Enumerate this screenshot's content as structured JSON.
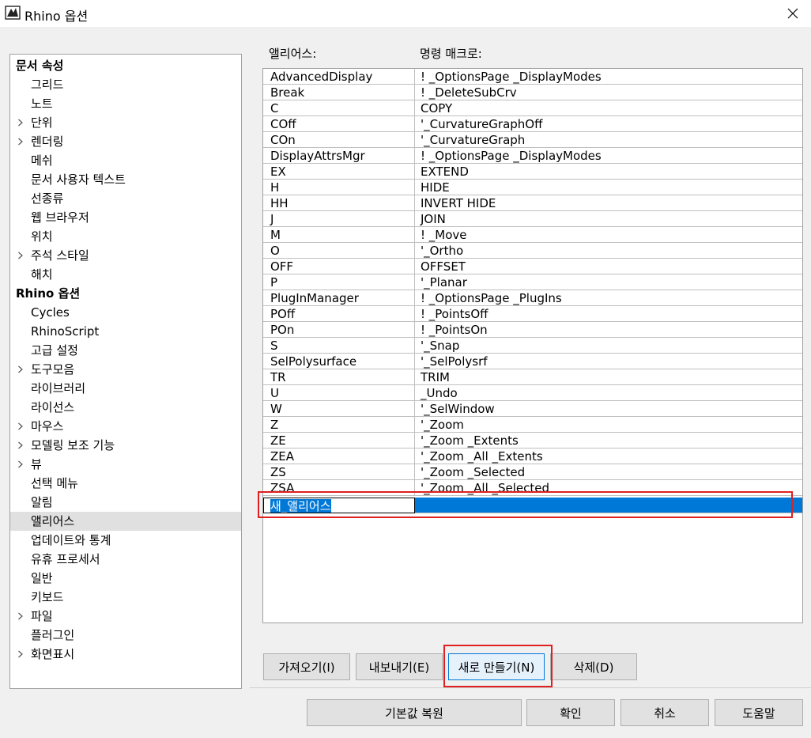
{
  "window": {
    "title": "Rhino 옵션"
  },
  "tree": {
    "items": [
      {
        "label": "문서 속성",
        "level": 0,
        "chevron": false
      },
      {
        "label": "그리드",
        "level": 1,
        "chevron": false
      },
      {
        "label": "노트",
        "level": 1,
        "chevron": false
      },
      {
        "label": "단위",
        "level": 1,
        "chevron": true
      },
      {
        "label": "렌더링",
        "level": 1,
        "chevron": true
      },
      {
        "label": "메쉬",
        "level": 1,
        "chevron": false
      },
      {
        "label": "문서 사용자 텍스트",
        "level": 1,
        "chevron": false
      },
      {
        "label": "선종류",
        "level": 1,
        "chevron": false
      },
      {
        "label": "웹 브라우저",
        "level": 1,
        "chevron": false
      },
      {
        "label": "위치",
        "level": 1,
        "chevron": false
      },
      {
        "label": "주석 스타일",
        "level": 1,
        "chevron": true
      },
      {
        "label": "해치",
        "level": 1,
        "chevron": false
      },
      {
        "label": "Rhino 옵션",
        "level": 0,
        "chevron": false
      },
      {
        "label": "Cycles",
        "level": 1,
        "chevron": false
      },
      {
        "label": "RhinoScript",
        "level": 1,
        "chevron": false
      },
      {
        "label": "고급 설정",
        "level": 1,
        "chevron": false
      },
      {
        "label": "도구모음",
        "level": 1,
        "chevron": true
      },
      {
        "label": "라이브러리",
        "level": 1,
        "chevron": false
      },
      {
        "label": "라이선스",
        "level": 1,
        "chevron": false
      },
      {
        "label": "마우스",
        "level": 1,
        "chevron": true
      },
      {
        "label": "모델링 보조 기능",
        "level": 1,
        "chevron": true
      },
      {
        "label": "뷰",
        "level": 1,
        "chevron": true
      },
      {
        "label": "선택 메뉴",
        "level": 1,
        "chevron": false
      },
      {
        "label": "알림",
        "level": 1,
        "chevron": false
      },
      {
        "label": "앨리어스",
        "level": 1,
        "chevron": false,
        "selected": true
      },
      {
        "label": "업데이트와 통계",
        "level": 1,
        "chevron": false
      },
      {
        "label": "유휴 프로세서",
        "level": 1,
        "chevron": false
      },
      {
        "label": "일반",
        "level": 1,
        "chevron": false
      },
      {
        "label": "키보드",
        "level": 1,
        "chevron": false
      },
      {
        "label": "파일",
        "level": 1,
        "chevron": true
      },
      {
        "label": "플러그인",
        "level": 1,
        "chevron": false
      },
      {
        "label": "화면표시",
        "level": 1,
        "chevron": true
      }
    ]
  },
  "aliases": {
    "col_alias": "앨리어스:",
    "col_macro": "명령 매크로:",
    "rows": [
      {
        "alias": "AdvancedDisplay",
        "macro": "! _OptionsPage _DisplayModes"
      },
      {
        "alias": "Break",
        "macro": "! _DeleteSubCrv"
      },
      {
        "alias": "C",
        "macro": "COPY"
      },
      {
        "alias": "COff",
        "macro": "'_CurvatureGraphOff"
      },
      {
        "alias": "COn",
        "macro": "'_CurvatureGraph"
      },
      {
        "alias": "DisplayAttrsMgr",
        "macro": "! _OptionsPage _DisplayModes"
      },
      {
        "alias": "EX",
        "macro": "EXTEND"
      },
      {
        "alias": "H",
        "macro": "HIDE"
      },
      {
        "alias": "HH",
        "macro": "INVERT HIDE"
      },
      {
        "alias": "J",
        "macro": "JOIN"
      },
      {
        "alias": "M",
        "macro": "! _Move"
      },
      {
        "alias": "O",
        "macro": "'_Ortho"
      },
      {
        "alias": "OFF",
        "macro": "OFFSET"
      },
      {
        "alias": "P",
        "macro": "'_Planar"
      },
      {
        "alias": "PlugInManager",
        "macro": "! _OptionsPage _PlugIns"
      },
      {
        "alias": "POff",
        "macro": "! _PointsOff"
      },
      {
        "alias": "POn",
        "macro": "! _PointsOn"
      },
      {
        "alias": "S",
        "macro": "'_Snap"
      },
      {
        "alias": "SelPolysurface",
        "macro": "'_SelPolysrf"
      },
      {
        "alias": "TR",
        "macro": "TRIM"
      },
      {
        "alias": "U",
        "macro": "_Undo"
      },
      {
        "alias": "W",
        "macro": "'_SelWindow"
      },
      {
        "alias": "Z",
        "macro": "'_Zoom"
      },
      {
        "alias": "ZE",
        "macro": "'_Zoom _Extents"
      },
      {
        "alias": "ZEA",
        "macro": "'_Zoom _All _Extents"
      },
      {
        "alias": "ZS",
        "macro": "'_Zoom _Selected"
      },
      {
        "alias": "ZSA",
        "macro": "'_Zoom _All _Selected"
      }
    ],
    "new_row": {
      "alias": "새_앨리어스",
      "macro": ""
    }
  },
  "buttons": {
    "import": "가져오기(I)",
    "export": "내보내기(E)",
    "new": "새로 만들기(N)",
    "delete": "삭제(D)",
    "restore": "기본값 복원",
    "ok": "확인",
    "cancel": "취소",
    "help": "도움말"
  },
  "colors": {
    "selection": "#0078d7",
    "annotation": "#e02020"
  }
}
